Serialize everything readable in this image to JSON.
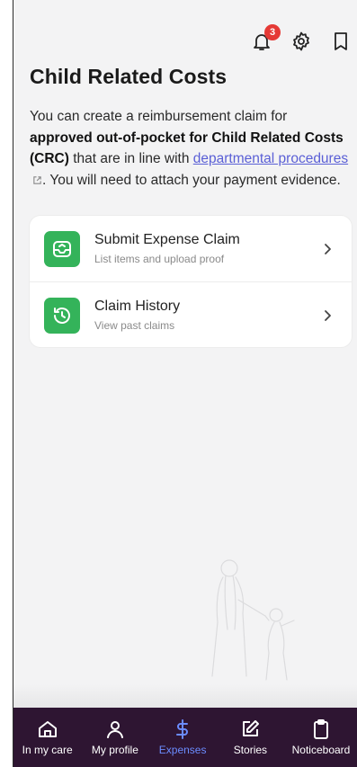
{
  "topbar": {
    "notification_count": "3",
    "icons": [
      "bell-icon",
      "gear-icon",
      "bookmark-icon"
    ]
  },
  "page": {
    "title": "Child Related Costs",
    "intro": {
      "part1": "You can create a reimbursement claim for ",
      "bold": "approved out-of-pocket for Child Related Costs (CRC)",
      "part2": " that are in line with ",
      "link": "departmental procedures",
      "part3": ". You will need to attach your payment evidence."
    }
  },
  "actions": [
    {
      "title": "Submit Expense Claim",
      "subtitle": "List items and upload proof",
      "icon": "inbox-upload-icon"
    },
    {
      "title": "Claim History",
      "subtitle": "View past claims",
      "icon": "history-icon"
    }
  ],
  "nav": [
    {
      "label": "In my care",
      "icon": "home-icon"
    },
    {
      "label": "My profile",
      "icon": "user-icon"
    },
    {
      "label": "Expenses",
      "icon": "dollar-icon",
      "active": true
    },
    {
      "label": "Stories",
      "icon": "edit-icon"
    },
    {
      "label": "Noticeboard",
      "icon": "clipboard-icon"
    }
  ],
  "colors": {
    "accent": "#6b8cff",
    "nav_bg": "#2e1532",
    "action_icon_bg": "#34b35a",
    "badge": "#e53935",
    "link": "#5a5fd6"
  }
}
